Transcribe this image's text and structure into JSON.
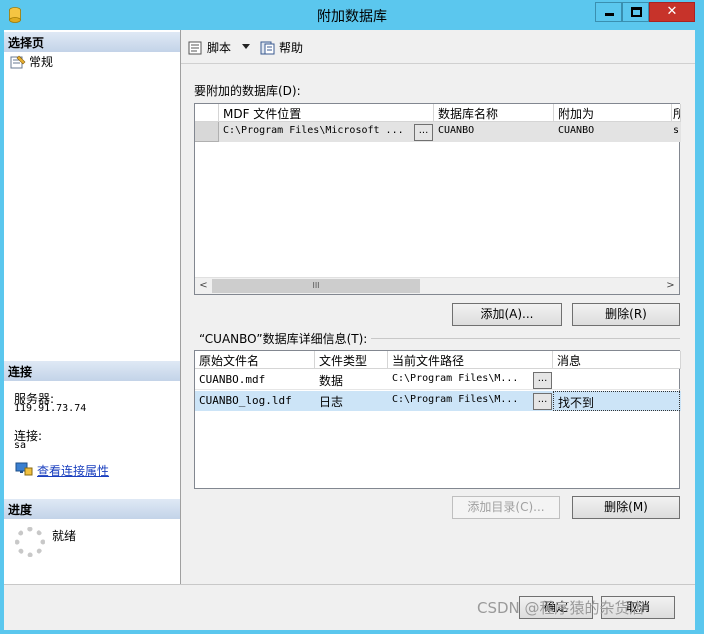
{
  "window": {
    "title": "附加数据库",
    "close_glyph": "✕"
  },
  "left": {
    "select_page_header": "选择页",
    "pages": [
      {
        "label": "常规"
      }
    ],
    "connection_header": "连接",
    "server_label": "服务器:",
    "server_value": "119.91.73.74",
    "connection_label": "连接:",
    "connection_value": "sa",
    "view_connection_link": "查看连接属性",
    "progress_header": "进度",
    "progress_status": "就绪"
  },
  "toolbar": {
    "script_label": "脚本",
    "help_label": "帮助"
  },
  "attach": {
    "section_label": "要附加的数据库(D):",
    "columns": [
      "MDF 文件位置",
      "数据库名称",
      "附加为",
      "所"
    ],
    "rows": [
      {
        "mdf_location": "C:\\Program Files\\Microsoft ...",
        "db_name": "CUANBO",
        "attach_as": "CUANBO",
        "owner": "s"
      }
    ],
    "ellipsis": "...",
    "scroll_left": "<",
    "scroll_right": ">",
    "scroll_grip": "III",
    "add_button": "添加(A)...",
    "remove_button": "删除(R)"
  },
  "details": {
    "section_label": "“CUANBO”数据库详细信息(T):",
    "columns": [
      "原始文件名",
      "文件类型",
      "当前文件路径",
      "消息"
    ],
    "rows": [
      {
        "file_name": "CUANBO.mdf",
        "file_type": "数据",
        "path": "C:\\Program Files\\M...",
        "message": ""
      },
      {
        "file_name": "CUANBO_log.ldf",
        "file_type": "日志",
        "path": "C:\\Program Files\\M...",
        "message": "找不到"
      }
    ],
    "add_catalog_button": "添加目录(C)...",
    "remove_button": "删除(M)"
  },
  "footer": {
    "ok_button": "确定",
    "cancel_button": "取消"
  },
  "watermark": "CSDN @程序猿的杂货店",
  "colors": {
    "titlebar": "#5bc7ee",
    "selection": "#cce4f7",
    "close": "#c7332a"
  }
}
